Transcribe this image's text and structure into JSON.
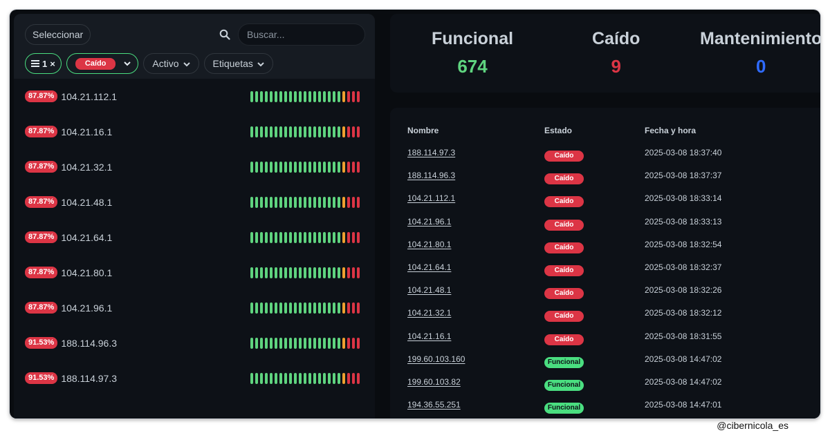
{
  "toolbar": {
    "select_label": "Seleccionar",
    "search_placeholder": "Buscar...",
    "filter_count": "1",
    "filter_clear": "×",
    "status_filter": "Caído",
    "active_dropdown": "Activo",
    "tags_dropdown": "Etiquetas"
  },
  "colors": {
    "up": "#5fd47f",
    "warn": "#f0a030",
    "down": "#dc3545",
    "maintenance": "#2f6bff"
  },
  "monitors": [
    {
      "uptime": "87.87%",
      "name": "104.21.112.1",
      "beats": "uuuuuuuuuuuuuuuuuuuwddd"
    },
    {
      "uptime": "87.87%",
      "name": "104.21.16.1",
      "beats": "uuuuuuuuuuuuuuuuuuuwddd"
    },
    {
      "uptime": "87.87%",
      "name": "104.21.32.1",
      "beats": "uuuuuuuuuuuuuuuuuuuwddd"
    },
    {
      "uptime": "87.87%",
      "name": "104.21.48.1",
      "beats": "uuuuuuuuuuuuuuuuuuuwddd"
    },
    {
      "uptime": "87.87%",
      "name": "104.21.64.1",
      "beats": "uuuuuuuuuuuuuuuuuuuwddd"
    },
    {
      "uptime": "87.87%",
      "name": "104.21.80.1",
      "beats": "uuuuuuuuuuuuuuuuuuuwddd"
    },
    {
      "uptime": "87.87%",
      "name": "104.21.96.1",
      "beats": "uuuuuuuuuuuuuuuuuuuwddd"
    },
    {
      "uptime": "91.53%",
      "name": "188.114.96.3",
      "beats": "uuuuuuuuuuuuuuuuuuuwddd"
    },
    {
      "uptime": "91.53%",
      "name": "188.114.97.3",
      "beats": "uuuuuuuuuuuuuuuuuuuwddd"
    }
  ],
  "stats": {
    "up_label": "Funcional",
    "up_value": "674",
    "down_label": "Caído",
    "down_value": "9",
    "maint_label": "Mantenimiento",
    "maint_value": "0"
  },
  "table": {
    "headers": [
      "Nombre",
      "Estado",
      "Fecha y hora"
    ],
    "rows": [
      {
        "name": "188.114.97.3",
        "status": "Caído",
        "state": "down",
        "date": "2025-03-08 18:37:40"
      },
      {
        "name": "188.114.96.3",
        "status": "Caído",
        "state": "down",
        "date": "2025-03-08 18:37:37"
      },
      {
        "name": "104.21.112.1",
        "status": "Caído",
        "state": "down",
        "date": "2025-03-08 18:33:14"
      },
      {
        "name": "104.21.96.1",
        "status": "Caído",
        "state": "down",
        "date": "2025-03-08 18:33:13"
      },
      {
        "name": "104.21.80.1",
        "status": "Caído",
        "state": "down",
        "date": "2025-03-08 18:32:54"
      },
      {
        "name": "104.21.64.1",
        "status": "Caído",
        "state": "down",
        "date": "2025-03-08 18:32:37"
      },
      {
        "name": "104.21.48.1",
        "status": "Caído",
        "state": "down",
        "date": "2025-03-08 18:32:26"
      },
      {
        "name": "104.21.32.1",
        "status": "Caído",
        "state": "down",
        "date": "2025-03-08 18:32:12"
      },
      {
        "name": "104.21.16.1",
        "status": "Caído",
        "state": "down",
        "date": "2025-03-08 18:31:55"
      },
      {
        "name": "199.60.103.160",
        "status": "Funcional",
        "state": "up",
        "date": "2025-03-08 14:47:02"
      },
      {
        "name": "199.60.103.82",
        "status": "Funcional",
        "state": "up",
        "date": "2025-03-08 14:47:02"
      },
      {
        "name": "194.36.55.251",
        "status": "Funcional",
        "state": "up",
        "date": "2025-03-08 14:47:01"
      }
    ]
  },
  "watermark": "@cibernicola_es"
}
